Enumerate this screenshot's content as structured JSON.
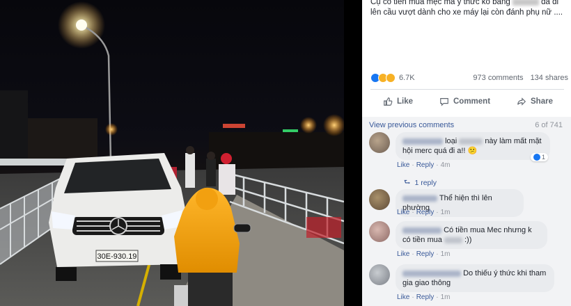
{
  "photo": {
    "plate": "30E-930.19"
  },
  "post": {
    "caption_start": "Cụ có tiền mua mẹc mà ý thức ko bằng",
    "caption_end": "đã đi lên cầu vượt dành cho xe máy lại còn đánh phụ nữ ....",
    "reaction_count": "6.7K",
    "comments_count": "973 comments",
    "shares_count": "134 shares",
    "actions": {
      "like": "Like",
      "comment": "Comment",
      "share": "Share"
    }
  },
  "comments_section": {
    "view_previous": "View previous comments",
    "page_count": "6 of 741",
    "comments": [
      {
        "text_a": "loại",
        "text_b": "này làm mất mặt hội merc quá đi a!! 😕",
        "actions": {
          "like": "Like",
          "reply": "Reply"
        },
        "time": "4m",
        "like_count": "1",
        "reply_link": "1 reply"
      },
      {
        "text": "Thể hiện thì lên phường",
        "actions": {
          "like": "Like",
          "reply": "Reply"
        },
        "time": "1m"
      },
      {
        "text_a": "Có tiền mua Mec nhưng k có tiền mua",
        "text_b": ":))",
        "actions": {
          "like": "Like",
          "reply": "Reply"
        },
        "time": "1m"
      },
      {
        "text": "Do thiếu ý thức khi tham gia giao thông",
        "actions": {
          "like": "Like",
          "reply": "Reply"
        },
        "time": "1m"
      }
    ]
  },
  "colors": {
    "link": "#385898",
    "bubble": "#e9ebee",
    "comments_bg": "#f2f3f5",
    "like_blue": "#1877f2"
  },
  "icons": [
    "like-thumb-icon",
    "comment-bubble-icon",
    "share-arrow-icon",
    "reply-arrow-icon",
    "reaction-like-icon",
    "reaction-haha-icon",
    "reaction-wow-icon"
  ]
}
